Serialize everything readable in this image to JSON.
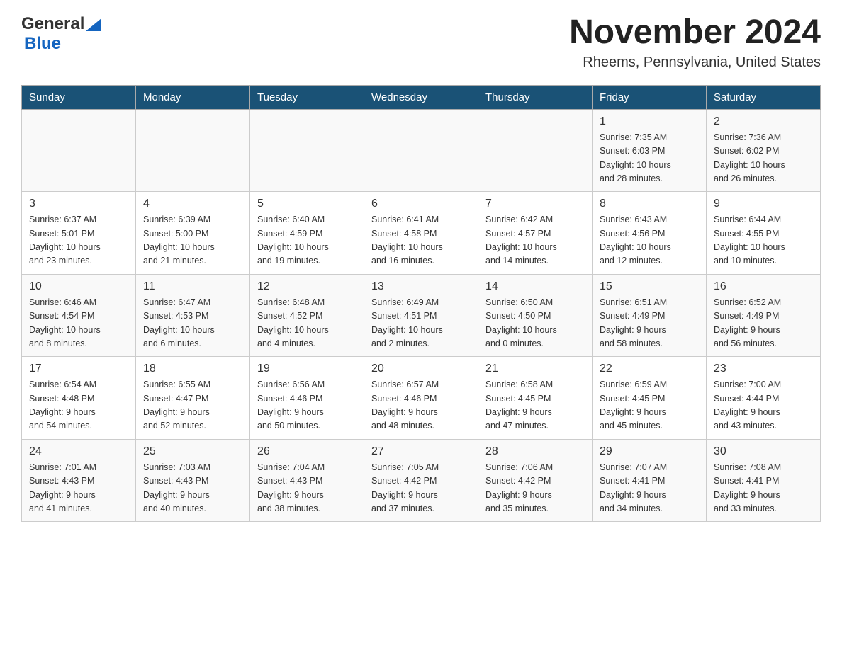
{
  "header": {
    "logo_general": "General",
    "logo_blue": "Blue",
    "month_title": "November 2024",
    "location": "Rheems, Pennsylvania, United States"
  },
  "days_of_week": [
    "Sunday",
    "Monday",
    "Tuesday",
    "Wednesday",
    "Thursday",
    "Friday",
    "Saturday"
  ],
  "weeks": [
    {
      "days": [
        {
          "number": "",
          "info": ""
        },
        {
          "number": "",
          "info": ""
        },
        {
          "number": "",
          "info": ""
        },
        {
          "number": "",
          "info": ""
        },
        {
          "number": "",
          "info": ""
        },
        {
          "number": "1",
          "info": "Sunrise: 7:35 AM\nSunset: 6:03 PM\nDaylight: 10 hours\nand 28 minutes."
        },
        {
          "number": "2",
          "info": "Sunrise: 7:36 AM\nSunset: 6:02 PM\nDaylight: 10 hours\nand 26 minutes."
        }
      ]
    },
    {
      "days": [
        {
          "number": "3",
          "info": "Sunrise: 6:37 AM\nSunset: 5:01 PM\nDaylight: 10 hours\nand 23 minutes."
        },
        {
          "number": "4",
          "info": "Sunrise: 6:39 AM\nSunset: 5:00 PM\nDaylight: 10 hours\nand 21 minutes."
        },
        {
          "number": "5",
          "info": "Sunrise: 6:40 AM\nSunset: 4:59 PM\nDaylight: 10 hours\nand 19 minutes."
        },
        {
          "number": "6",
          "info": "Sunrise: 6:41 AM\nSunset: 4:58 PM\nDaylight: 10 hours\nand 16 minutes."
        },
        {
          "number": "7",
          "info": "Sunrise: 6:42 AM\nSunset: 4:57 PM\nDaylight: 10 hours\nand 14 minutes."
        },
        {
          "number": "8",
          "info": "Sunrise: 6:43 AM\nSunset: 4:56 PM\nDaylight: 10 hours\nand 12 minutes."
        },
        {
          "number": "9",
          "info": "Sunrise: 6:44 AM\nSunset: 4:55 PM\nDaylight: 10 hours\nand 10 minutes."
        }
      ]
    },
    {
      "days": [
        {
          "number": "10",
          "info": "Sunrise: 6:46 AM\nSunset: 4:54 PM\nDaylight: 10 hours\nand 8 minutes."
        },
        {
          "number": "11",
          "info": "Sunrise: 6:47 AM\nSunset: 4:53 PM\nDaylight: 10 hours\nand 6 minutes."
        },
        {
          "number": "12",
          "info": "Sunrise: 6:48 AM\nSunset: 4:52 PM\nDaylight: 10 hours\nand 4 minutes."
        },
        {
          "number": "13",
          "info": "Sunrise: 6:49 AM\nSunset: 4:51 PM\nDaylight: 10 hours\nand 2 minutes."
        },
        {
          "number": "14",
          "info": "Sunrise: 6:50 AM\nSunset: 4:50 PM\nDaylight: 10 hours\nand 0 minutes."
        },
        {
          "number": "15",
          "info": "Sunrise: 6:51 AM\nSunset: 4:49 PM\nDaylight: 9 hours\nand 58 minutes."
        },
        {
          "number": "16",
          "info": "Sunrise: 6:52 AM\nSunset: 4:49 PM\nDaylight: 9 hours\nand 56 minutes."
        }
      ]
    },
    {
      "days": [
        {
          "number": "17",
          "info": "Sunrise: 6:54 AM\nSunset: 4:48 PM\nDaylight: 9 hours\nand 54 minutes."
        },
        {
          "number": "18",
          "info": "Sunrise: 6:55 AM\nSunset: 4:47 PM\nDaylight: 9 hours\nand 52 minutes."
        },
        {
          "number": "19",
          "info": "Sunrise: 6:56 AM\nSunset: 4:46 PM\nDaylight: 9 hours\nand 50 minutes."
        },
        {
          "number": "20",
          "info": "Sunrise: 6:57 AM\nSunset: 4:46 PM\nDaylight: 9 hours\nand 48 minutes."
        },
        {
          "number": "21",
          "info": "Sunrise: 6:58 AM\nSunset: 4:45 PM\nDaylight: 9 hours\nand 47 minutes."
        },
        {
          "number": "22",
          "info": "Sunrise: 6:59 AM\nSunset: 4:45 PM\nDaylight: 9 hours\nand 45 minutes."
        },
        {
          "number": "23",
          "info": "Sunrise: 7:00 AM\nSunset: 4:44 PM\nDaylight: 9 hours\nand 43 minutes."
        }
      ]
    },
    {
      "days": [
        {
          "number": "24",
          "info": "Sunrise: 7:01 AM\nSunset: 4:43 PM\nDaylight: 9 hours\nand 41 minutes."
        },
        {
          "number": "25",
          "info": "Sunrise: 7:03 AM\nSunset: 4:43 PM\nDaylight: 9 hours\nand 40 minutes."
        },
        {
          "number": "26",
          "info": "Sunrise: 7:04 AM\nSunset: 4:43 PM\nDaylight: 9 hours\nand 38 minutes."
        },
        {
          "number": "27",
          "info": "Sunrise: 7:05 AM\nSunset: 4:42 PM\nDaylight: 9 hours\nand 37 minutes."
        },
        {
          "number": "28",
          "info": "Sunrise: 7:06 AM\nSunset: 4:42 PM\nDaylight: 9 hours\nand 35 minutes."
        },
        {
          "number": "29",
          "info": "Sunrise: 7:07 AM\nSunset: 4:41 PM\nDaylight: 9 hours\nand 34 minutes."
        },
        {
          "number": "30",
          "info": "Sunrise: 7:08 AM\nSunset: 4:41 PM\nDaylight: 9 hours\nand 33 minutes."
        }
      ]
    }
  ]
}
